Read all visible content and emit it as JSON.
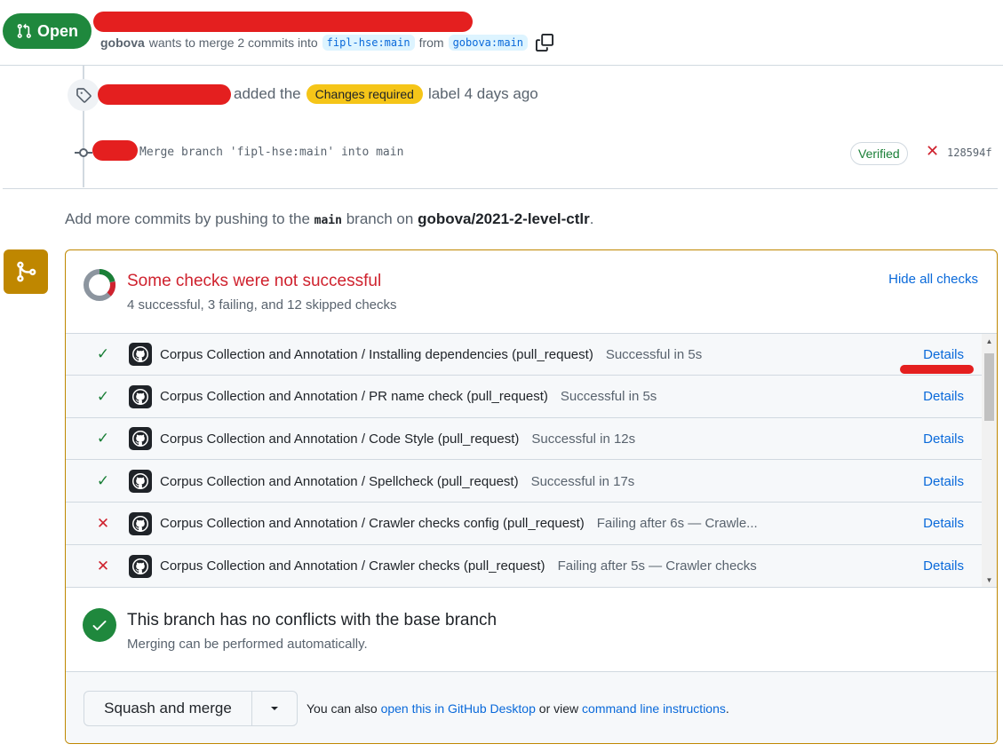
{
  "header": {
    "state_label": "Open",
    "author": "gobova",
    "merge_text": "wants to merge 2 commits into",
    "base_branch": "fipl-hse:main",
    "from_text": "from",
    "head_branch": "gobova:main"
  },
  "timeline": {
    "label_event": {
      "added_text": "added the",
      "label_name": "Changes required",
      "after_text": "label 4 days ago",
      "label_color": "#f5c518"
    },
    "commit": {
      "message": "Merge branch 'fipl-hse:main' into main",
      "verified_label": "Verified",
      "sha": "128594f"
    }
  },
  "push_info": {
    "prefix": "Add more commits by pushing to the",
    "branch": "main",
    "middle": "branch on",
    "repo": "gobova/2021-2-level-ctlr",
    "suffix": "."
  },
  "checks": {
    "title": "Some checks were not successful",
    "summary": "4 successful, 3 failing, and 12 skipped checks",
    "hide_label": "Hide all checks",
    "details_label": "Details",
    "items": [
      {
        "status": "success",
        "name": "Corpus Collection and Annotation / Installing dependencies (pull_request)",
        "desc": "Successful in 5s"
      },
      {
        "status": "success",
        "name": "Corpus Collection and Annotation / PR name check (pull_request)",
        "desc": "Successful in 5s"
      },
      {
        "status": "success",
        "name": "Corpus Collection and Annotation / Code Style (pull_request)",
        "desc": "Successful in 12s"
      },
      {
        "status": "success",
        "name": "Corpus Collection and Annotation / Spellcheck (pull_request)",
        "desc": "Successful in 17s"
      },
      {
        "status": "failure",
        "name": "Corpus Collection and Annotation / Crawler checks config (pull_request)",
        "desc": "Failing after 6s — Crawle..."
      },
      {
        "status": "failure",
        "name": "Corpus Collection and Annotation / Crawler checks (pull_request)",
        "desc": "Failing after 5s — Crawler checks"
      }
    ]
  },
  "conflicts": {
    "title": "This branch has no conflicts with the base branch",
    "subtitle": "Merging can be performed automatically."
  },
  "merge": {
    "button_label": "Squash and merge",
    "also_prefix": "You can also",
    "desktop_link": "open this in GitHub Desktop",
    "or_text": "or view",
    "cli_link": "command line instructions",
    "suffix": "."
  }
}
